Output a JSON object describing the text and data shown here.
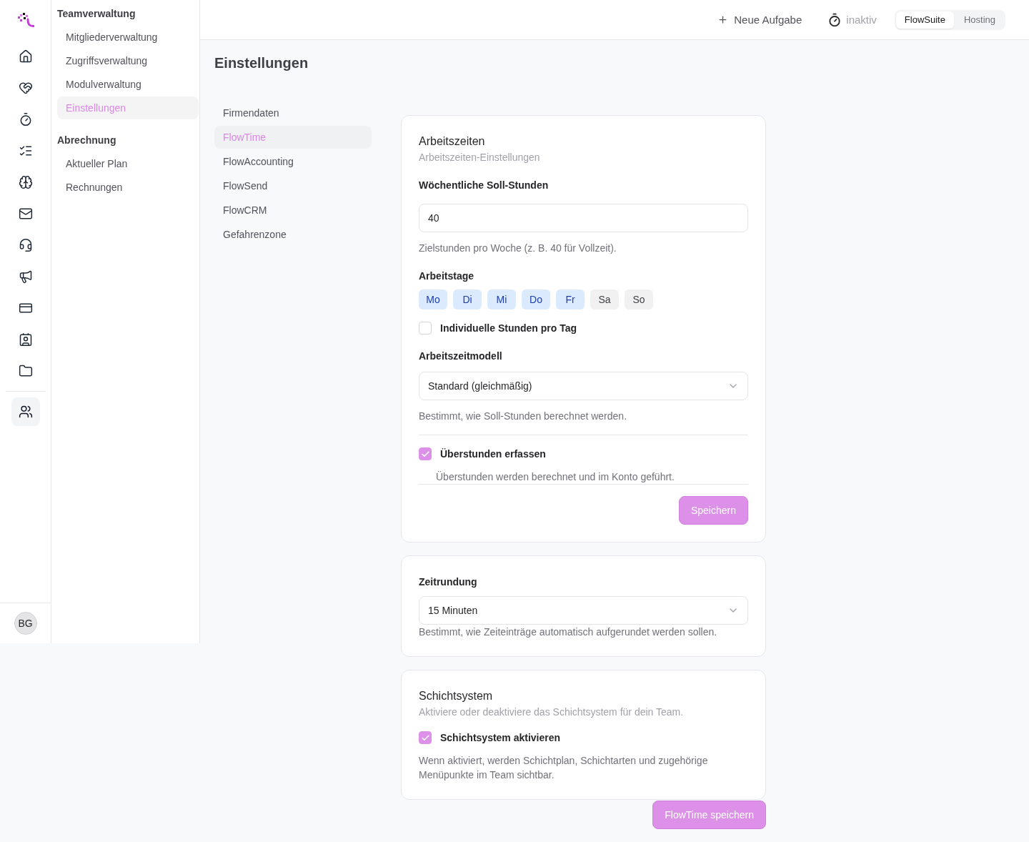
{
  "rail": {
    "apps": [
      {
        "selected": false
      },
      {
        "selected": false
      },
      {
        "selected": false
      },
      {
        "selected": false
      },
      {
        "selected": false
      },
      {
        "selected": false
      },
      {
        "selected": false
      },
      {
        "selected": false
      },
      {
        "selected": false
      },
      {
        "selected": false
      },
      {
        "selected": false
      }
    ],
    "team": [
      {
        "selected": true
      }
    ],
    "avatar": {
      "initials": "BG"
    }
  },
  "sidebar": {
    "sections": [
      {
        "title": "Teamverwaltung",
        "items": [
          {
            "label": "Mitgliederverwaltung",
            "selected": false
          },
          {
            "label": "Zugriffsverwaltung",
            "selected": false
          },
          {
            "label": "Modulverwaltung",
            "selected": false
          },
          {
            "label": "Einstellungen",
            "selected": true
          }
        ]
      },
      {
        "title": "Abrechnung",
        "items": [
          {
            "label": "Aktueller Plan",
            "selected": false
          },
          {
            "label": "Rechnungen",
            "selected": false
          }
        ]
      }
    ]
  },
  "header": {
    "new_task": "Neue Aufgabe",
    "timer": {
      "status": "inaktiv"
    },
    "workspace_switch": [
      {
        "label": "FlowSuite",
        "selected": true
      },
      {
        "label": "Hosting",
        "selected": false
      }
    ]
  },
  "page": {
    "title": "Einstellungen"
  },
  "settings_nav": [
    {
      "label": "Firmendaten",
      "selected": false
    },
    {
      "label": "FlowTime",
      "selected": true
    },
    {
      "label": "FlowAccounting",
      "selected": false
    },
    {
      "label": "FlowSend",
      "selected": false
    },
    {
      "label": "FlowCRM",
      "selected": false
    },
    {
      "label": "Gefahrenzone",
      "selected": false
    }
  ],
  "working_hours": {
    "title": "Arbeitszeiten",
    "subtitle": "Arbeitszeiten-Einstellungen",
    "weekly_hours": {
      "label": "Wöchentliche Soll-Stunden",
      "value": "40",
      "hint": "Zielstunden pro Woche (z. B. 40 für Vollzeit)."
    },
    "workdays": {
      "label": "Arbeitstage",
      "days": [
        {
          "label": "Mo",
          "selected": true
        },
        {
          "label": "Di",
          "selected": true
        },
        {
          "label": "Mi",
          "selected": true
        },
        {
          "label": "Do",
          "selected": true
        },
        {
          "label": "Fr",
          "selected": true
        },
        {
          "label": "Sa",
          "selected": false
        },
        {
          "label": "So",
          "selected": false
        }
      ]
    },
    "individual_hours": {
      "label": "Individuelle Stunden pro Tag",
      "checked": false
    },
    "model": {
      "label": "Arbeitszeitmodell",
      "value": "Standard (gleichmäßig)",
      "hint": "Bestimmt, wie Soll-Stunden berechnet werden."
    },
    "overtime": {
      "label": "Überstunden erfassen",
      "checked": true,
      "hint": "Überstunden werden berechnet und im Konto geführt."
    },
    "save": {
      "label": "Speichern",
      "disabled": true
    }
  },
  "time_rounding": {
    "label": "Zeitrundung",
    "value": "15 Minuten",
    "hint": "Bestimmt, wie Zeiteinträge automatisch aufgerundet werden sollen."
  },
  "shifts": {
    "title": "Schichtsystem",
    "subtitle": "Aktiviere oder deaktiviere das Schichtsystem für dein Team.",
    "enable": {
      "label": "Schichtsystem aktivieren",
      "checked": true
    },
    "note": "Wenn aktiviert, werden Schichtplan, Schichtarten und zugehörige Menüpunkte im Team sichtbar."
  },
  "save_all": {
    "label": "FlowTime speichern",
    "disabled": true
  }
}
